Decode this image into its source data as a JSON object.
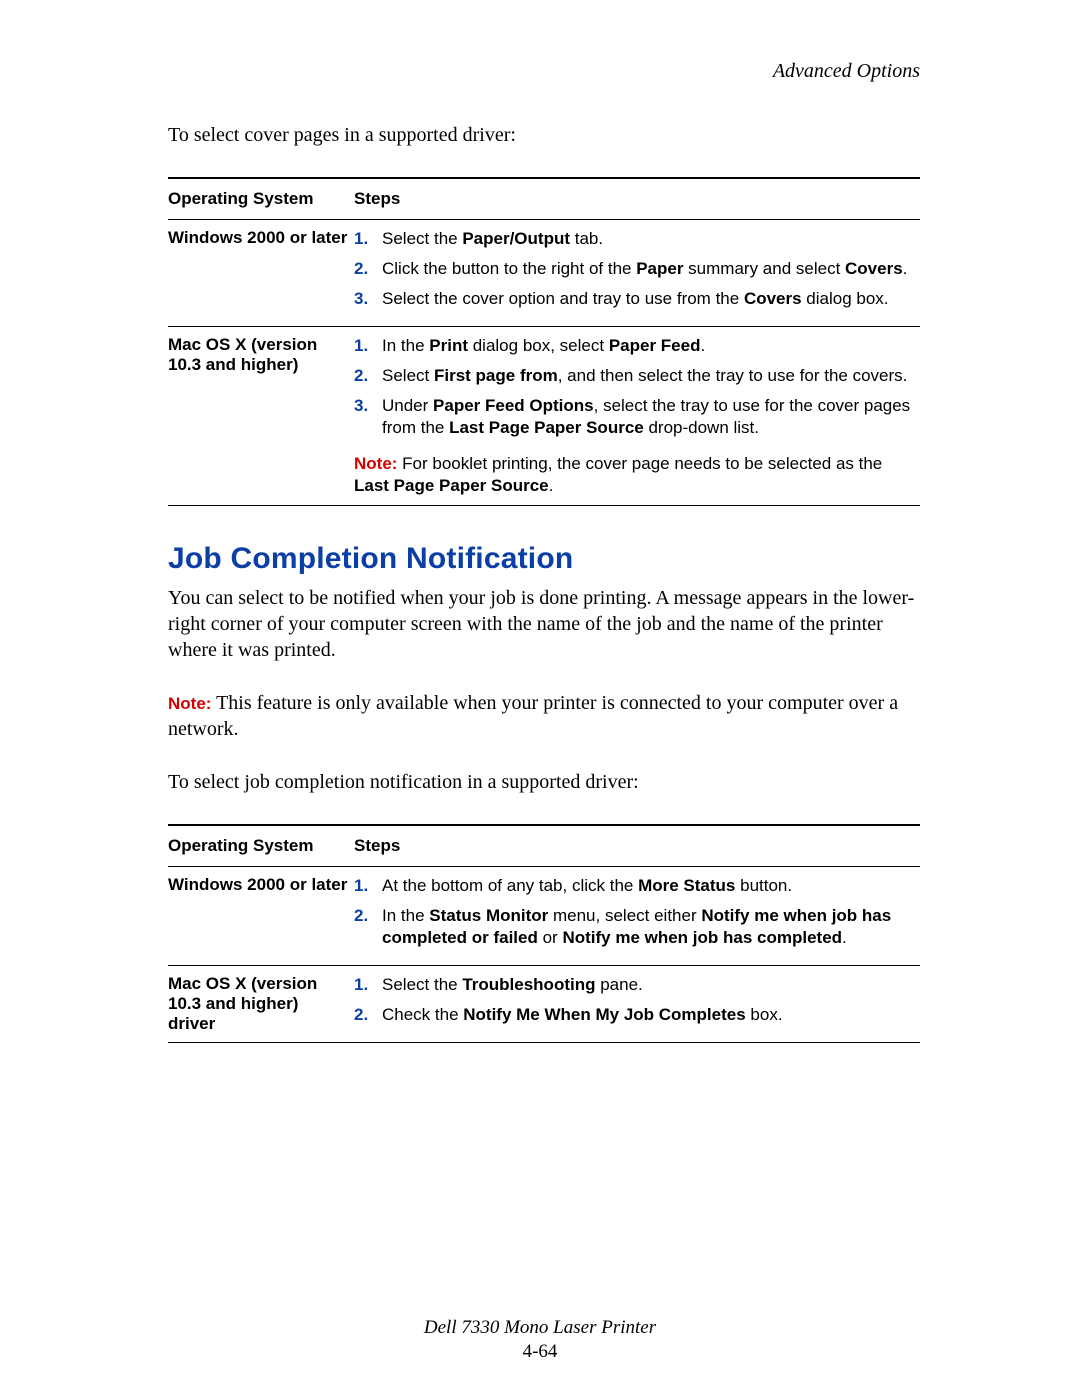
{
  "header": {
    "section": "Advanced Options"
  },
  "intro1": "To select cover pages in a supported driver:",
  "table1": {
    "cols": {
      "os": "Operating System",
      "steps": "Steps"
    },
    "rows": [
      {
        "os": "Windows 2000 or later",
        "steps": [
          [
            {
              "t": "Select the "
            },
            {
              "t": "Paper/Output",
              "b": true
            },
            {
              "t": " tab."
            }
          ],
          [
            {
              "t": "Click the button to the right of the "
            },
            {
              "t": "Paper",
              "b": true
            },
            {
              "t": " summary and select "
            },
            {
              "t": "Covers",
              "b": true
            },
            {
              "t": "."
            }
          ],
          [
            {
              "t": "Select the cover option and tray to use from the "
            },
            {
              "t": "Covers",
              "b": true
            },
            {
              "t": " dialog box."
            }
          ]
        ]
      },
      {
        "os": "Mac OS X (version 10.3 and higher)",
        "steps": [
          [
            {
              "t": "In the "
            },
            {
              "t": "Print",
              "b": true
            },
            {
              "t": " dialog box, select "
            },
            {
              "t": "Paper Feed",
              "b": true
            },
            {
              "t": "."
            }
          ],
          [
            {
              "t": "Select "
            },
            {
              "t": "First page from",
              "b": true
            },
            {
              "t": ", and then select the tray to use for the covers."
            }
          ],
          [
            {
              "t": "Under "
            },
            {
              "t": "Paper Feed Options",
              "b": true
            },
            {
              "t": ", select the tray to use for the cover pages from the "
            },
            {
              "t": "Last Page Paper Source",
              "b": true
            },
            {
              "t": " drop-down list."
            }
          ]
        ],
        "note": {
          "label": "Note:",
          "runs": [
            {
              "t": " For booklet printing, the cover page needs to be selected as the "
            },
            {
              "t": "Last Page Paper Source",
              "b": true
            },
            {
              "t": "."
            }
          ]
        }
      }
    ]
  },
  "heading": "Job Completion Notification",
  "para1": "You can select to be notified when your job is done done printing. A message appears in the lower-right corner of your computer screen with the name of the job and the name of the printer where it was printed.",
  "para1_fixed": "You can select to be notified when your job is done printing. A message appears in the lower-right corner of your computer screen with the name of the job and the name of the printer where it was printed.",
  "note2": {
    "label": "Note:",
    "text": " This feature is only available when your printer is connected to your computer over a network."
  },
  "intro2": "To select job completion notification in a supported driver:",
  "table2": {
    "cols": {
      "os": "Operating System",
      "steps": "Steps"
    },
    "rows": [
      {
        "os": "Windows 2000 or later",
        "steps": [
          [
            {
              "t": "At the bottom of any tab, click the "
            },
            {
              "t": "More Status",
              "b": true
            },
            {
              "t": " button."
            }
          ],
          [
            {
              "t": "In the "
            },
            {
              "t": "Status Monitor",
              "b": true
            },
            {
              "t": " menu, select either "
            },
            {
              "t": "Notify me when job has completed or failed",
              "b": true
            },
            {
              "t": " or "
            },
            {
              "t": "Notify me when job has completed",
              "b": true
            },
            {
              "t": "."
            }
          ]
        ]
      },
      {
        "os": "Mac OS X (version 10.3 and higher) driver",
        "steps": [
          [
            {
              "t": "Select the "
            },
            {
              "t": "Troubleshooting",
              "b": true
            },
            {
              "t": " pane."
            }
          ],
          [
            {
              "t": "Check the "
            },
            {
              "t": "Notify Me When My Job Completes",
              "b": true
            },
            {
              "t": " box."
            }
          ]
        ]
      }
    ]
  },
  "footer": {
    "product": "Dell 7330 Mono Laser Printer",
    "page": "4-64"
  }
}
